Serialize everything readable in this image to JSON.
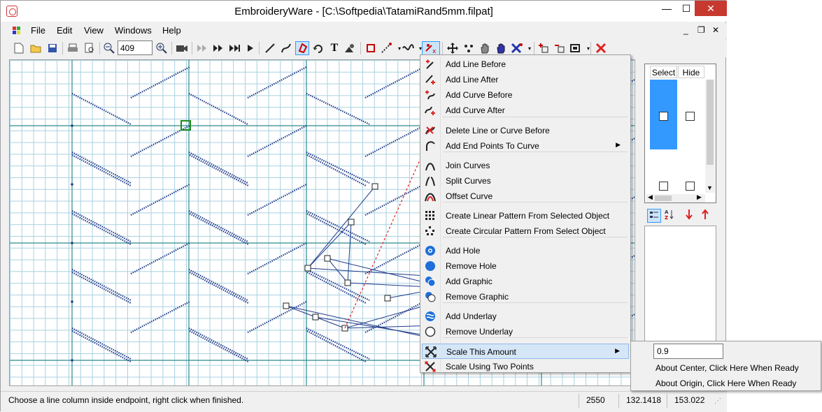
{
  "window": {
    "title": "EmbroideryWare - [C:\\Softpedia\\TatamiRand5mm.filpat]"
  },
  "window_controls": {
    "minimize": "—",
    "maximize": "☐",
    "close": "✕"
  },
  "mdi_controls": {
    "minimize": "_",
    "restore": "❐",
    "close": "✕"
  },
  "menubar": {
    "items": [
      "File",
      "Edit",
      "View",
      "Windows",
      "Help"
    ]
  },
  "toolbar": {
    "zoom_value": "409"
  },
  "layers_panel": {
    "col_select": "Select",
    "col_hide": "Hide"
  },
  "context_menu": {
    "items": [
      {
        "label": "Add Line Before",
        "icon": "add-line-before-icon"
      },
      {
        "label": "Add Line After",
        "icon": "add-line-after-icon"
      },
      {
        "label": "Add Curve Before",
        "icon": "add-curve-before-icon"
      },
      {
        "label": "Add Curve After",
        "icon": "add-curve-after-icon"
      },
      {
        "label": "Delete Line or Curve Before",
        "icon": "delete-line-icon"
      },
      {
        "label": "Add End Points To Curve",
        "icon": "end-points-icon",
        "submenu": true
      },
      {
        "label": "Join Curves",
        "icon": "join-curves-icon"
      },
      {
        "label": "Split Curves",
        "icon": "split-curves-icon"
      },
      {
        "label": "Offset Curve",
        "icon": "offset-curve-icon"
      },
      {
        "label": "Create Linear Pattern From Selected Object",
        "icon": "linear-pattern-icon"
      },
      {
        "label": "Create Circular Pattern From Select Object",
        "icon": "circular-pattern-icon"
      },
      {
        "label": "Add Hole",
        "icon": "add-hole-icon"
      },
      {
        "label": "Remove Hole",
        "icon": "remove-hole-icon"
      },
      {
        "label": "Add Graphic",
        "icon": "add-graphic-icon"
      },
      {
        "label": "Remove Graphic",
        "icon": "remove-graphic-icon"
      },
      {
        "label": "Add Underlay",
        "icon": "add-underlay-icon"
      },
      {
        "label": "Remove Underlay",
        "icon": "remove-underlay-icon"
      },
      {
        "label": "Scale This Amount",
        "icon": "scale-amount-icon",
        "submenu": true,
        "highlighted": true
      },
      {
        "label": "Scale Using Two Points",
        "icon": "scale-two-points-icon"
      }
    ]
  },
  "submenu": {
    "value": "0.9",
    "items": [
      "About Center, Click Here When Ready",
      "About Origin, Click Here When Ready"
    ]
  },
  "statusbar": {
    "message": "Choose a line column inside endpoint, right click when finished.",
    "count": "2550",
    "x": "132.1418",
    "y": "153.022"
  },
  "colors": {
    "accent": "#3399ff",
    "stitch": "#1f3a8a",
    "grid": "#a8d0e0",
    "guide": "#2e8b8b",
    "highlight": "#d5e6f7"
  }
}
